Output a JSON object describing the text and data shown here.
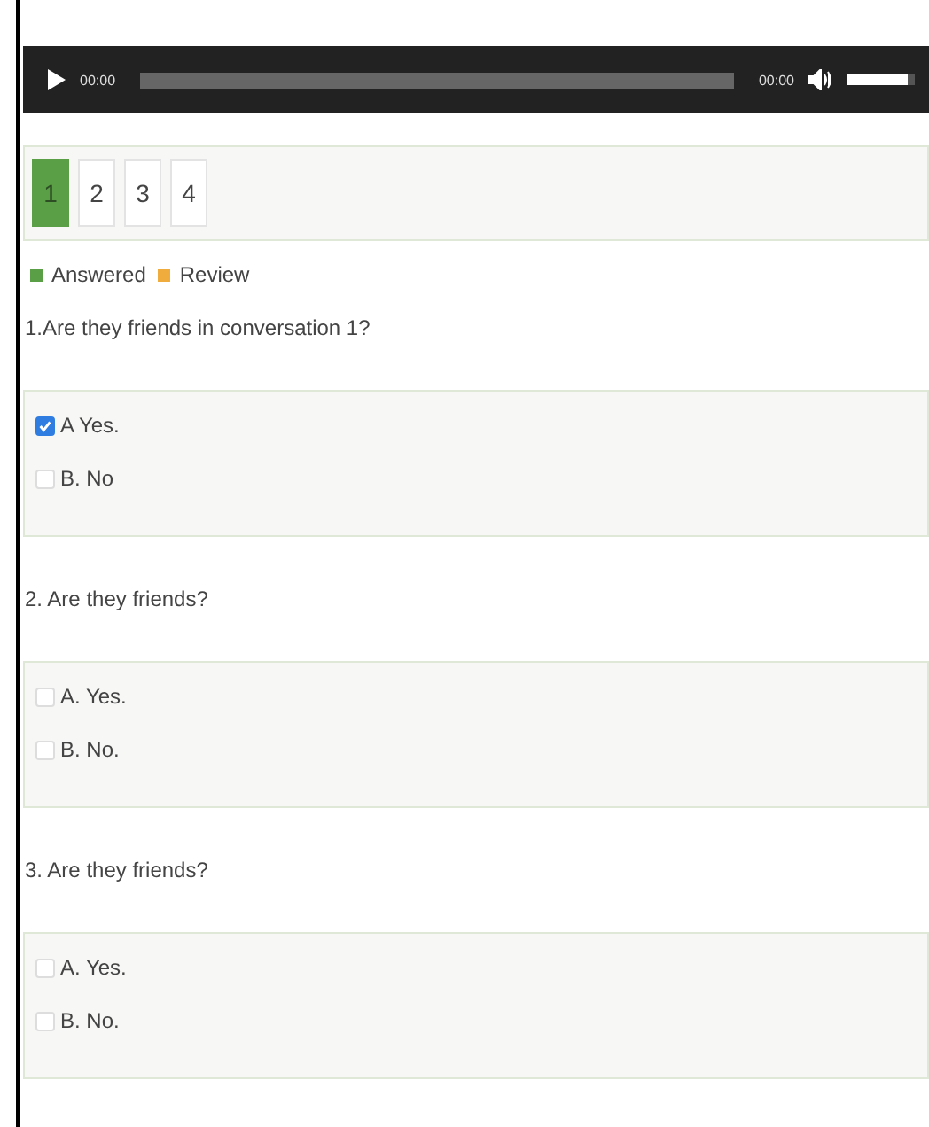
{
  "player": {
    "current_time": "00:00",
    "duration": "00:00",
    "volume": {
      "level": 0.9
    }
  },
  "pages": [
    {
      "label": "1",
      "answered": true
    },
    {
      "label": "2",
      "answered": false
    },
    {
      "label": "3",
      "answered": false
    },
    {
      "label": "4",
      "answered": false
    }
  ],
  "legend": [
    {
      "label": "Answered",
      "color": "#5a9e46"
    },
    {
      "label": "Review",
      "color": "#f0ad3e"
    }
  ],
  "questions": [
    {
      "text": "1.Are they friends in conversation 1?",
      "options": [
        {
          "label": "A Yes.",
          "checked": true
        },
        {
          "label": "B. No",
          "checked": false
        }
      ]
    },
    {
      "text": "2. Are they friends?",
      "options": [
        {
          "label": "A. Yes.",
          "checked": false
        },
        {
          "label": "B. No.",
          "checked": false
        }
      ]
    },
    {
      "text": "3. Are they friends?",
      "options": [
        {
          "label": "A. Yes.",
          "checked": false
        },
        {
          "label": "B. No.",
          "checked": false
        }
      ]
    }
  ]
}
